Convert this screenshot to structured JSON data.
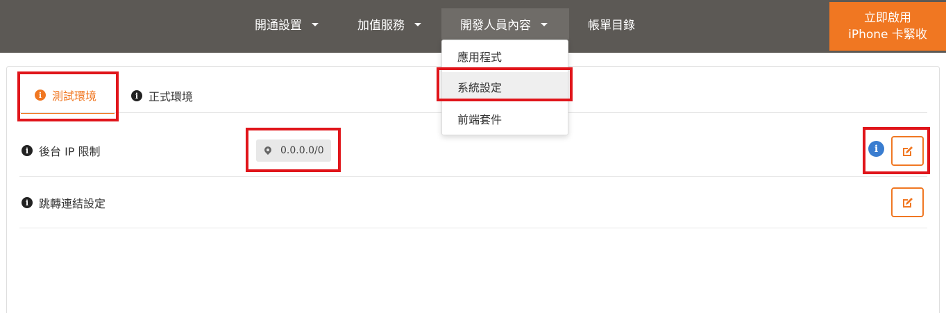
{
  "nav": {
    "items": [
      {
        "label": "開通設置",
        "has_caret": true
      },
      {
        "label": "加值服務",
        "has_caret": true
      },
      {
        "label": "開發人員內容",
        "has_caret": true,
        "active": true
      },
      {
        "label": "帳單目錄",
        "has_caret": false
      }
    ],
    "cta": {
      "line1": "立即啟用",
      "line2": "iPhone 卡緊收"
    }
  },
  "dropdown": {
    "items": [
      {
        "label": "應用程式"
      },
      {
        "label": "系統設定",
        "hovered": true
      },
      {
        "label": "前端套件"
      }
    ]
  },
  "tabs": [
    {
      "label": "測試環境",
      "active": true
    },
    {
      "label": "正式環境",
      "active": false
    }
  ],
  "settings": {
    "ip_limit": {
      "label": "後台 IP 限制",
      "value": "0.0.0.0/0"
    },
    "redirect": {
      "label": "跳轉連結設定"
    }
  },
  "icons": {
    "info": "i"
  },
  "colors": {
    "nav_bg": "#5c5955",
    "accent": "#f07722",
    "highlight": "#e0151b",
    "info_blue": "#3a7dd0"
  }
}
